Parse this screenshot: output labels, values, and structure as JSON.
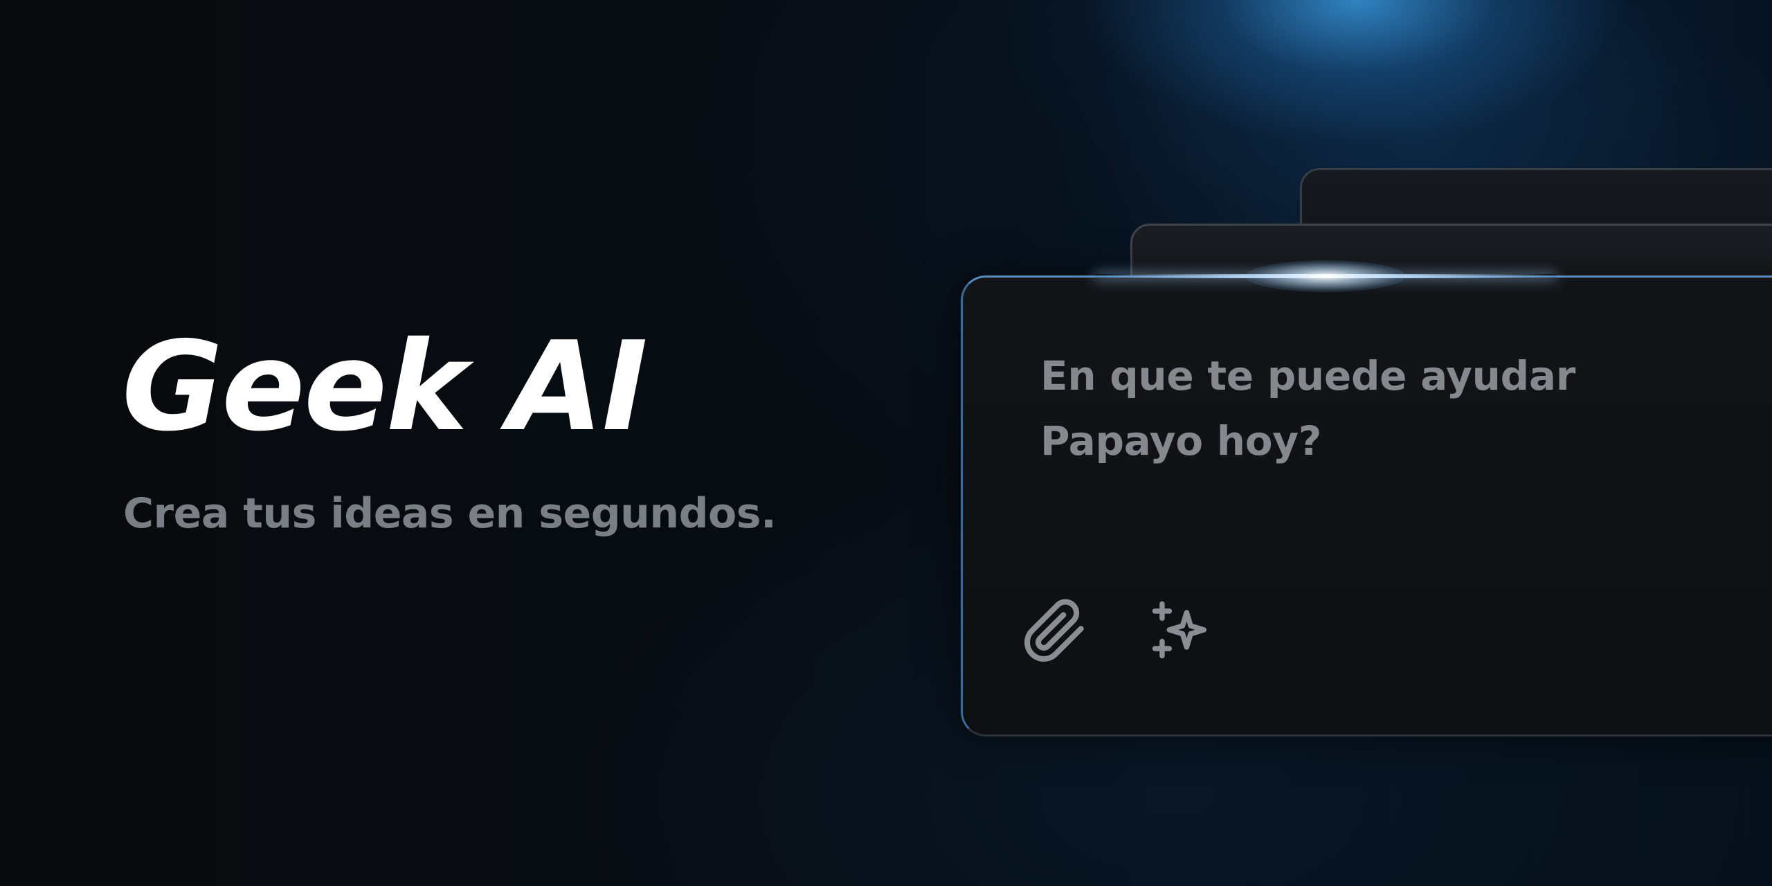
{
  "hero": {
    "title": "Geek AI",
    "subtitle": "Crea tus ideas en segundos."
  },
  "chat": {
    "prompt_line1": "En que te puede ayudar",
    "prompt_line2": "Papayo hoy?",
    "icons": [
      "paperclip-icon",
      "sparkles-icon"
    ]
  },
  "colors": {
    "background": "#070b10",
    "accent_glow": "#3896dc",
    "title": "#ffffff",
    "muted_text": "#7a7f85",
    "card_bg": "#121418"
  }
}
